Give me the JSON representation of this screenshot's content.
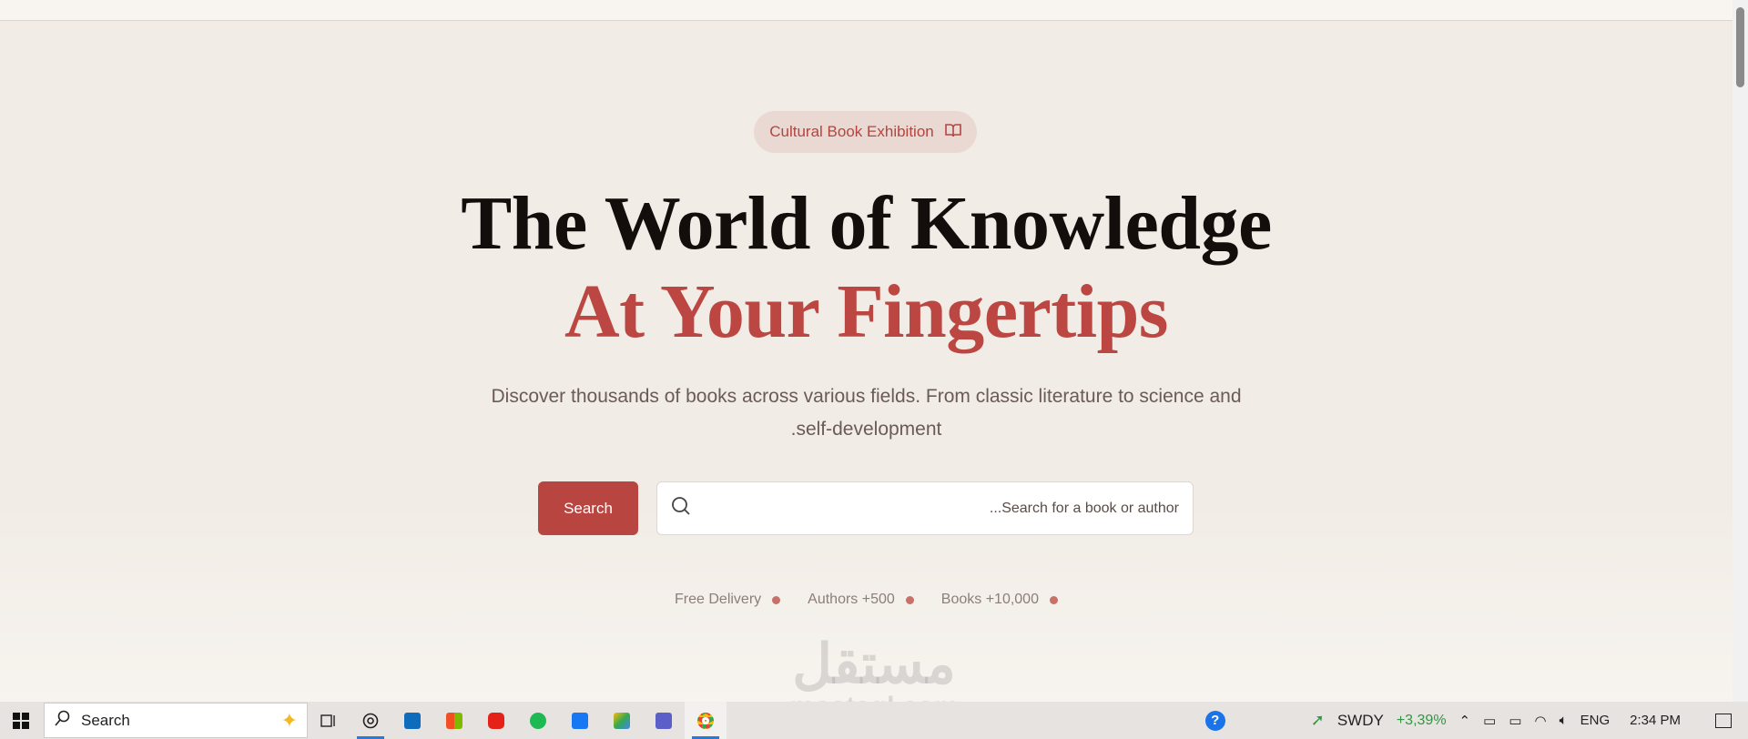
{
  "badge": {
    "label": "Cultural Book Exhibition",
    "icon": "book-open-icon"
  },
  "hero": {
    "title_line1": "The World of Knowledge",
    "title_line2": "At Your Fingertips",
    "subtitle_line1": "Discover thousands of books across various fields. From classic literature to science and",
    "subtitle_line2": ".self-development"
  },
  "search": {
    "button_label": "Search",
    "placeholder": "...Search for a book or author"
  },
  "features": [
    "Free Delivery",
    "Authors +500",
    "Books +10,000"
  ],
  "watermark": {
    "arabic": "مستقل",
    "latin": "mostaql.com"
  },
  "taskbar": {
    "search_label": "Search",
    "stock_symbol": "SWDY",
    "stock_change": "+3,39%",
    "language": "ENG",
    "time": "2:34 PM"
  },
  "colors": {
    "accent": "#b8453f",
    "background": "#f1ece6",
    "stock_up": "#2e9a3e"
  }
}
